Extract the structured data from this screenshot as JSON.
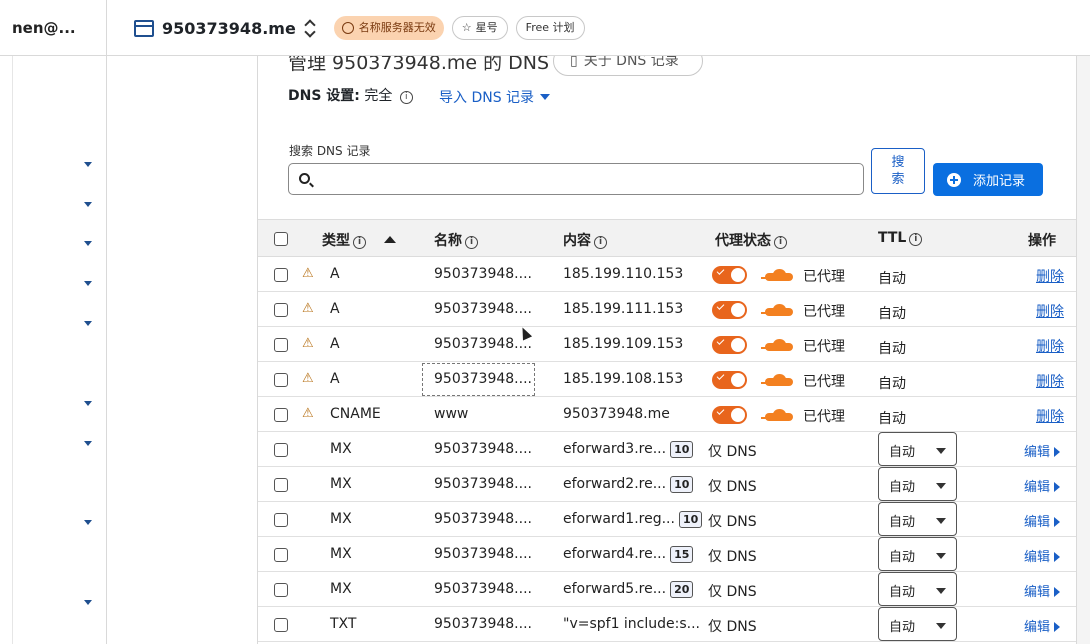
{
  "account": {
    "name": "nen@..."
  },
  "site": {
    "domain": "950373948.me",
    "status_badge": "名称服务器无效",
    "star_label": "星号",
    "plan_label": "Free 计划"
  },
  "page": {
    "title": "管理 950373948.me 的 DNS",
    "about_button": "关于 DNS 记录",
    "dns_setting_label": "DNS 设置:",
    "dns_setting_value": "完全",
    "import_label": "导入 DNS 记录",
    "search_label": "搜索 DNS 记录",
    "search_value": "",
    "search_button": "搜索",
    "add_button": "添加记录"
  },
  "table": {
    "headers": {
      "type": "类型",
      "name": "名称",
      "content": "内容",
      "proxy": "代理状态",
      "ttl": "TTL",
      "actions": "操作"
    },
    "proxied_rows": [
      {
        "type": "A",
        "name": "950373948....",
        "content": "185.199.110.153",
        "proxy_status": "已代理",
        "ttl": "自动",
        "action": "删除"
      },
      {
        "type": "A",
        "name": "950373948....",
        "content": "185.199.111.153",
        "proxy_status": "已代理",
        "ttl": "自动",
        "action": "删除"
      },
      {
        "type": "A",
        "name": "950373948....",
        "content": "185.199.109.153",
        "proxy_status": "已代理",
        "ttl": "自动",
        "action": "删除"
      },
      {
        "type": "A",
        "name": "950373948....",
        "content": "185.199.108.153",
        "proxy_status": "已代理",
        "ttl": "自动",
        "action": "删除"
      },
      {
        "type": "CNAME",
        "name": "www",
        "content": "950373948.me",
        "proxy_status": "已代理",
        "ttl": "自动",
        "action": "删除"
      }
    ],
    "dns_rows": [
      {
        "type": "MX",
        "name": "950373948....",
        "content": "eforward3.re...",
        "priority": "10",
        "proxy_status": "仅 DNS",
        "ttl": "自动",
        "action": "编辑"
      },
      {
        "type": "MX",
        "name": "950373948....",
        "content": "eforward2.re...",
        "priority": "10",
        "proxy_status": "仅 DNS",
        "ttl": "自动",
        "action": "编辑"
      },
      {
        "type": "MX",
        "name": "950373948....",
        "content": "eforward1.reg...",
        "priority": "10",
        "proxy_status": "仅 DNS",
        "ttl": "自动",
        "action": "编辑"
      },
      {
        "type": "MX",
        "name": "950373948....",
        "content": "eforward4.re...",
        "priority": "15",
        "proxy_status": "仅 DNS",
        "ttl": "自动",
        "action": "编辑"
      },
      {
        "type": "MX",
        "name": "950373948....",
        "content": "eforward5.re...",
        "priority": "20",
        "proxy_status": "仅 DNS",
        "ttl": "自动",
        "action": "编辑"
      },
      {
        "type": "TXT",
        "name": "950373948....",
        "content": "\"v=spf1 include:s...",
        "priority": "",
        "proxy_status": "仅 DNS",
        "ttl": "自动",
        "action": "编辑"
      }
    ]
  },
  "colors": {
    "accent": "#0a6fe0",
    "proxy_orange": "#f38020",
    "link": "#1a5fc6"
  }
}
